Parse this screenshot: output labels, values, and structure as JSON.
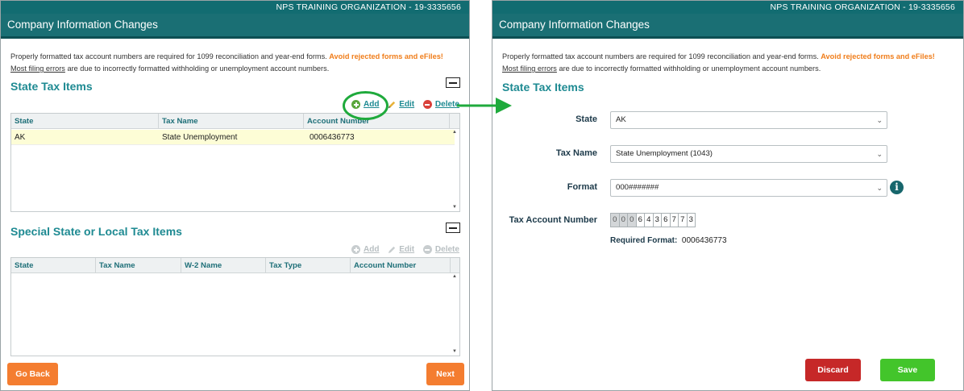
{
  "left": {
    "org": "NPS TRAINING ORGANIZATION - 19-3335656",
    "title": "Company Information Changes",
    "intro": {
      "line1": "Properly formatted tax account numbers are required for 1099 reconciliation and year-end forms. ",
      "warn": "Avoid rejected forms and eFiles!",
      "link": "Most filing errors",
      "line2": " are due to incorrectly formatted withholding or unemployment account numbers."
    },
    "state_section": {
      "title": "State Tax Items",
      "actions": {
        "add": "Add",
        "edit": "Edit",
        "delete": "Delete"
      },
      "columns": [
        "State",
        "Tax Name",
        "Account Number"
      ],
      "rows": [
        {
          "state": "AK",
          "tax_name": "State Unemployment",
          "account": "0006436773"
        }
      ]
    },
    "special_section": {
      "title": "Special State or Local Tax Items",
      "actions": {
        "add": "Add",
        "edit": "Edit",
        "delete": "Delete"
      },
      "columns": [
        "State",
        "Tax Name",
        "W-2 Name",
        "Tax Type",
        "Account Number"
      ]
    },
    "buttons": {
      "back": "Go Back",
      "next": "Next"
    }
  },
  "right": {
    "org": "NPS TRAINING ORGANIZATION - 19-3335656",
    "title": "Company Information Changes",
    "intro": {
      "line1": "Properly formatted tax account numbers are required for 1099 reconciliation and year-end forms. ",
      "warn": "Avoid rejected forms and eFiles!",
      "link": "Most filing errors",
      "line2": " are due to incorrectly formatted withholding or unemployment account numbers."
    },
    "section_title": "State Tax Items",
    "form": {
      "state_label": "State",
      "state_value": "AK",
      "tax_name_label": "Tax Name",
      "tax_name_value": "State Unemployment (1043)",
      "format_label": "Format",
      "format_value": "000#######",
      "account_label": "Tax Account Number",
      "account_digits": [
        "0",
        "0",
        "0",
        "6",
        "4",
        "3",
        "6",
        "7",
        "7",
        "3"
      ],
      "required_label": "Required Format:",
      "required_value": "0006436773"
    },
    "buttons": {
      "discard": "Discard",
      "save": "Save"
    }
  },
  "annotation": {
    "arrow_color": "#1faa3c",
    "ring_color": "#1faa3c"
  },
  "icons": [
    "plus-circle-icon",
    "pencil-icon",
    "minus-circle-icon",
    "collapse-icon",
    "chevron-down-icon",
    "info-icon"
  ]
}
